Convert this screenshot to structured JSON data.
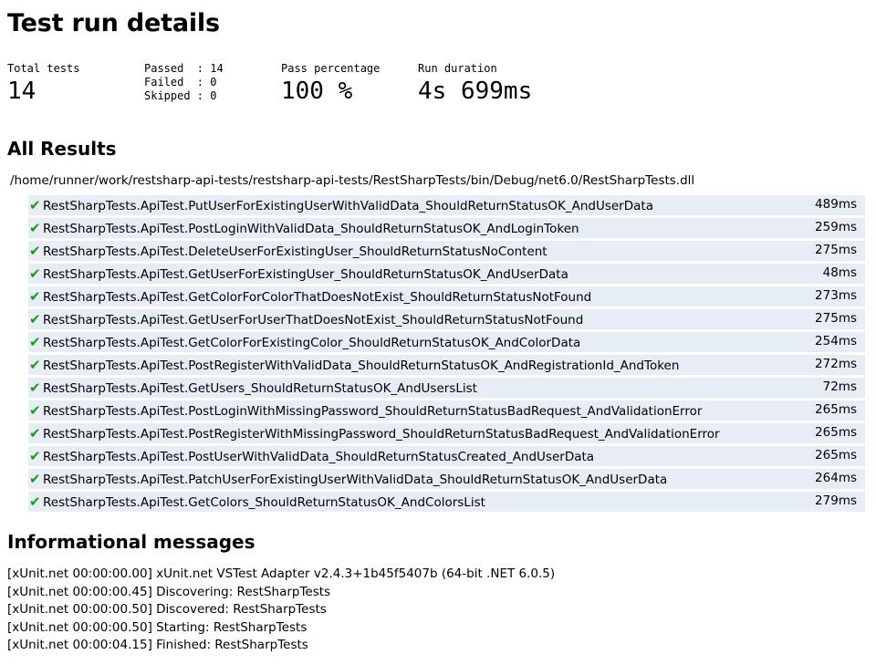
{
  "title": "Test run details",
  "summary": {
    "total_label": "Total tests",
    "total_value": "14",
    "passed_line": "Passed  : 14",
    "failed_line": "Failed  : 0",
    "skipped_line": "Skipped : 0",
    "percentage_label": "Pass percentage",
    "percentage_value": "100 %",
    "duration_label": "Run duration",
    "duration_value": "4s 699ms"
  },
  "results": {
    "heading": "All Results",
    "dll_path": "/home/runner/work/restsharp-api-tests/restsharp-api-tests/RestSharpTests/bin/Debug/net6.0/RestSharpTests.dll",
    "status_icon": "check-icon",
    "status_color": "#1a9a1a",
    "row_background": "#e6edf5",
    "tests": [
      {
        "name": "RestSharpTests.ApiTest.PutUserForExistingUserWithValidData_ShouldReturnStatusOK_AndUserData",
        "duration": "489ms"
      },
      {
        "name": "RestSharpTests.ApiTest.PostLoginWithValidData_ShouldReturnStatusOK_AndLoginToken",
        "duration": "259ms"
      },
      {
        "name": "RestSharpTests.ApiTest.DeleteUserForExistingUser_ShouldReturnStatusNoContent",
        "duration": "275ms"
      },
      {
        "name": "RestSharpTests.ApiTest.GetUserForExistingUser_ShouldReturnStatusOK_AndUserData",
        "duration": "48ms"
      },
      {
        "name": "RestSharpTests.ApiTest.GetColorForColorThatDoesNotExist_ShouldReturnStatusNotFound",
        "duration": "273ms"
      },
      {
        "name": "RestSharpTests.ApiTest.GetUserForUserThatDoesNotExist_ShouldReturnStatusNotFound",
        "duration": "275ms"
      },
      {
        "name": "RestSharpTests.ApiTest.GetColorForExistingColor_ShouldReturnStatusOK_AndColorData",
        "duration": "254ms"
      },
      {
        "name": "RestSharpTests.ApiTest.PostRegisterWithValidData_ShouldReturnStatusOK_AndRegistrationId_AndToken",
        "duration": "272ms"
      },
      {
        "name": "RestSharpTests.ApiTest.GetUsers_ShouldReturnStatusOK_AndUsersList",
        "duration": "72ms"
      },
      {
        "name": "RestSharpTests.ApiTest.PostLoginWithMissingPassword_ShouldReturnStatusBadRequest_AndValidationError",
        "duration": "265ms"
      },
      {
        "name": "RestSharpTests.ApiTest.PostRegisterWithMissingPassword_ShouldReturnStatusBadRequest_AndValidationError",
        "duration": "265ms"
      },
      {
        "name": "RestSharpTests.ApiTest.PostUserWithValidData_ShouldReturnStatusCreated_AndUserData",
        "duration": "265ms"
      },
      {
        "name": "RestSharpTests.ApiTest.PatchUserForExistingUserWithValidData_ShouldReturnStatusOK_AndUserData",
        "duration": "264ms"
      },
      {
        "name": "RestSharpTests.ApiTest.GetColors_ShouldReturnStatusOK_AndColorsList",
        "duration": "279ms"
      }
    ]
  },
  "messages": {
    "heading": "Informational messages",
    "lines": [
      "[xUnit.net 00:00:00.00] xUnit.net VSTest Adapter v2.4.3+1b45f5407b (64-bit .NET 6.0.5)",
      "[xUnit.net 00:00:00.45] Discovering: RestSharpTests",
      "[xUnit.net 00:00:00.50] Discovered: RestSharpTests",
      "[xUnit.net 00:00:00.50] Starting: RestSharpTests",
      "[xUnit.net 00:00:04.15] Finished: RestSharpTests"
    ]
  }
}
